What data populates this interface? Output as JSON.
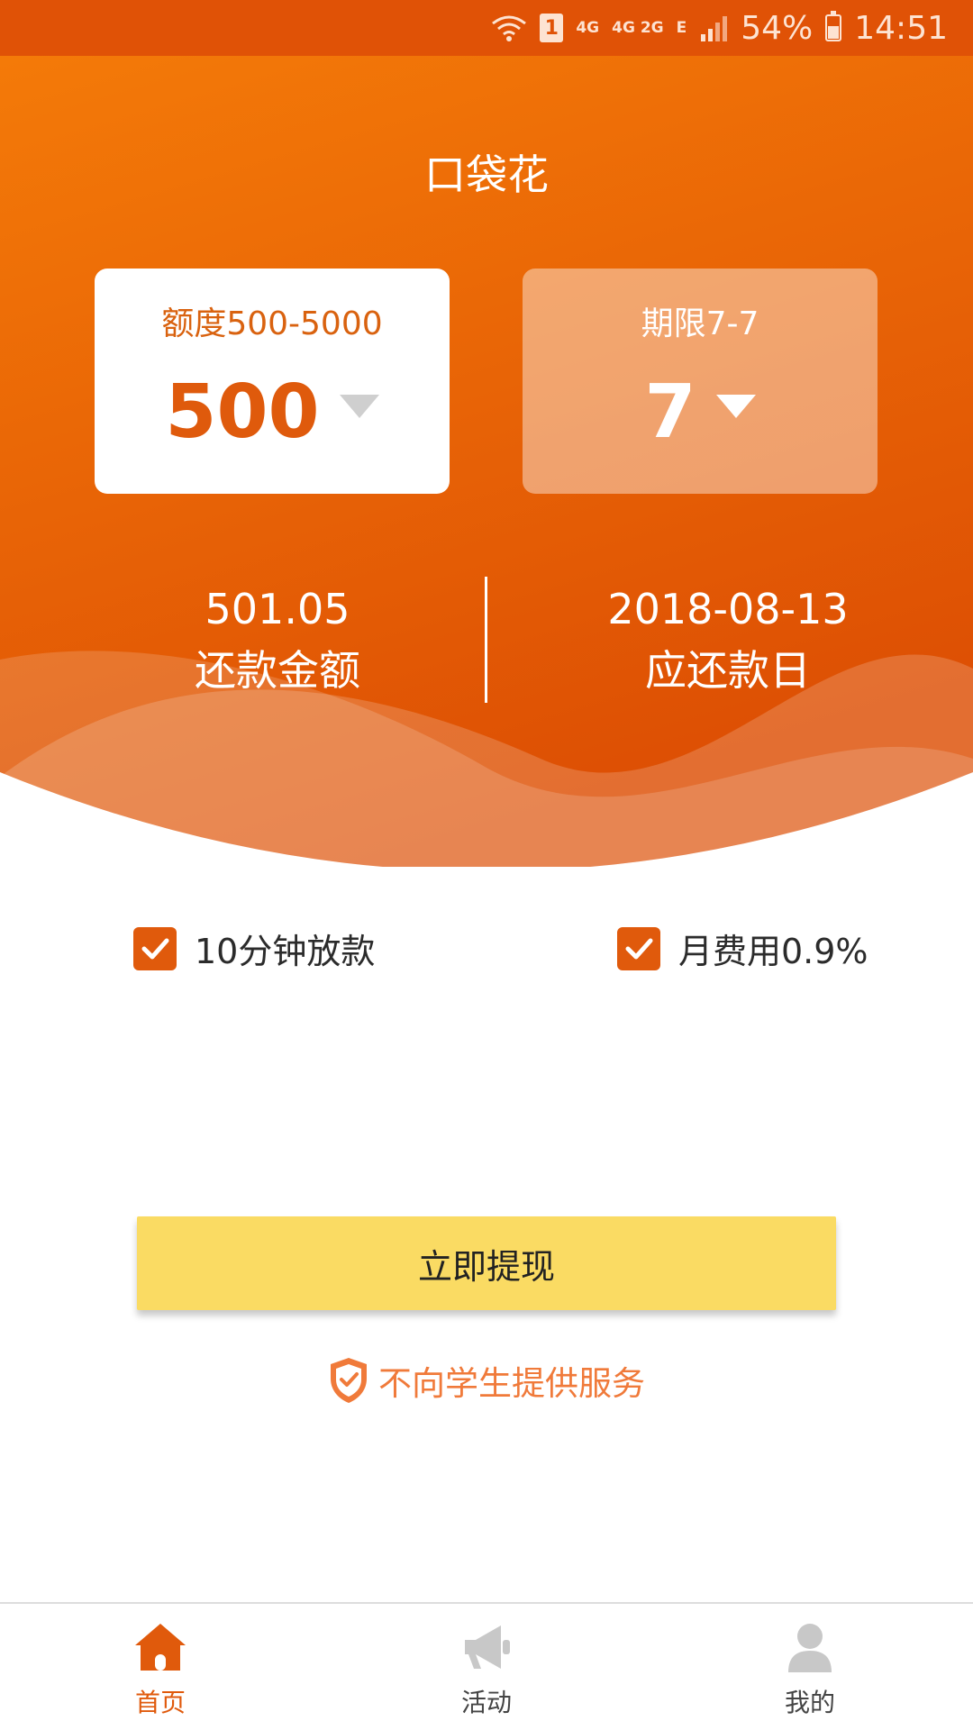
{
  "status_bar": {
    "sim_slot": "1",
    "network_1": "4G",
    "network_2": "4G 2G",
    "network_3": "E",
    "battery": "54%",
    "time": "14:51"
  },
  "app": {
    "title": "口袋花"
  },
  "loan_selector": {
    "amount": {
      "label": "额度500-5000",
      "value": "500"
    },
    "term": {
      "label": "期限7-7",
      "value": "7"
    }
  },
  "summary": {
    "repayment_amount": {
      "value": "501.05",
      "label": "还款金额"
    },
    "due_date": {
      "value": "2018-08-13",
      "label": "应还款日"
    }
  },
  "features": [
    {
      "label": "10分钟放款",
      "checked": true
    },
    {
      "label": "月费用0.9%",
      "checked": true
    }
  ],
  "cta": {
    "withdraw_label": "立即提现"
  },
  "notice": {
    "text": "不向学生提供服务"
  },
  "bottom_nav": [
    {
      "label": "首页",
      "icon": "home-icon",
      "active": true
    },
    {
      "label": "活动",
      "icon": "megaphone-icon",
      "active": false
    },
    {
      "label": "我的",
      "icon": "user-icon",
      "active": false
    }
  ],
  "colors": {
    "primary_orange": "#e05a0c",
    "button_yellow": "#fadb63",
    "notice_orange": "#f07a3a"
  }
}
